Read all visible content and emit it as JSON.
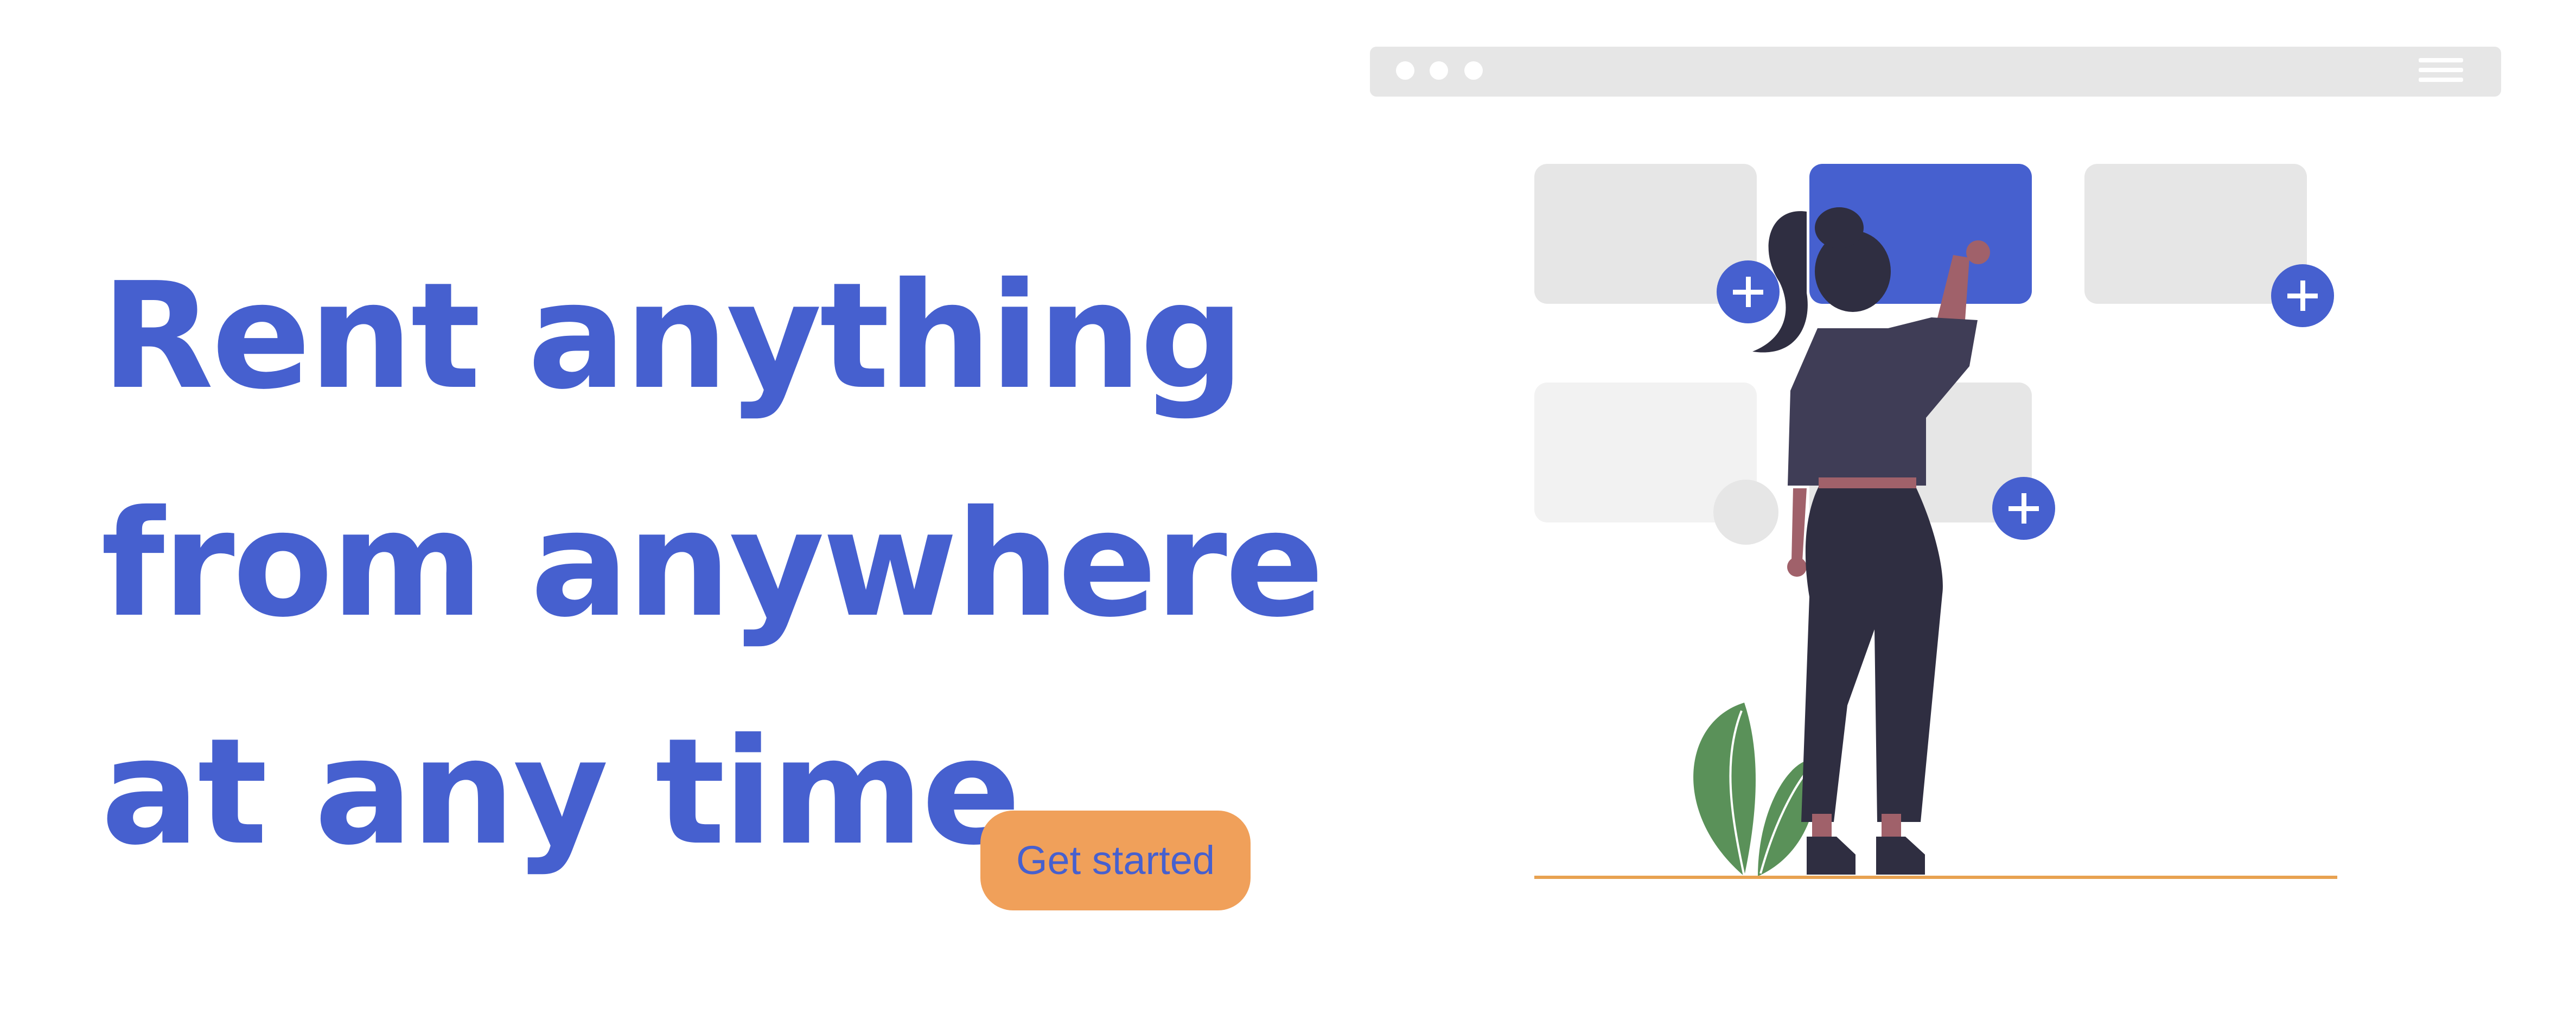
{
  "hero": {
    "headline_lines": [
      "Rent anything",
      "from anywhere",
      "at any time."
    ],
    "cta_label": "Get started"
  },
  "colors": {
    "brand_blue": "#4660CF",
    "cta_orange": "#F0A05A",
    "placeholder_gray": "#E6E6E6",
    "floor_line": "#E8A251",
    "plant_green": "#5A9159"
  },
  "illustration": {
    "icons": [
      "browser-window-icon",
      "hamburger-menu-icon",
      "plus-icon",
      "person-icon",
      "plant-icon"
    ]
  }
}
